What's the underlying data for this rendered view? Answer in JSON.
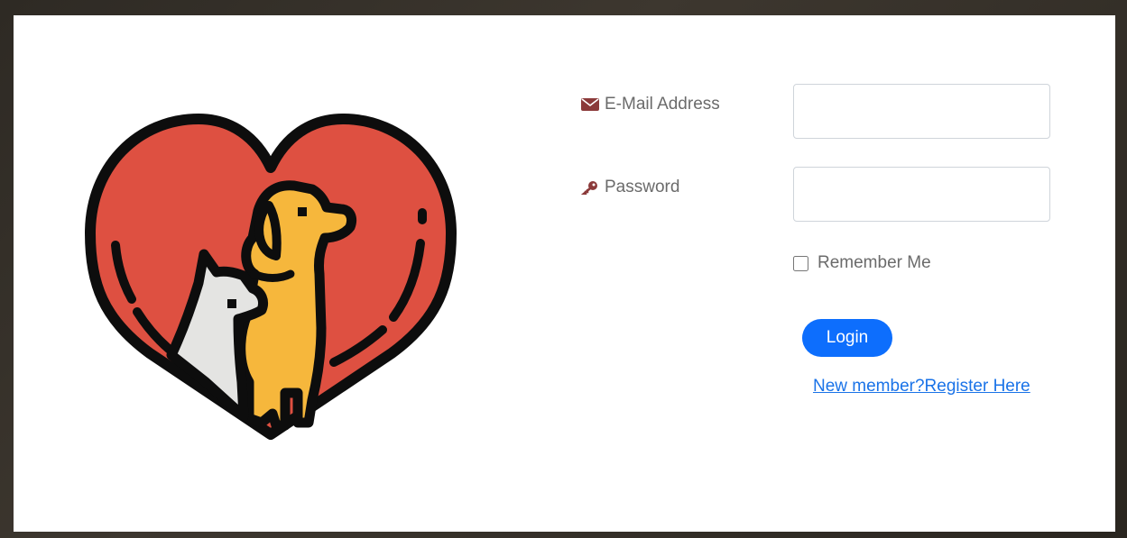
{
  "logo": {
    "icon": "pets-heart-logo",
    "colors": {
      "heart": "#de5041",
      "dog": "#f6b73c",
      "cat": "#e4e4e2",
      "outline": "#0d0d0d"
    }
  },
  "form": {
    "email": {
      "label": "E-Mail Address",
      "icon": "envelope-icon",
      "value": "",
      "placeholder": ""
    },
    "password": {
      "label": "Password",
      "icon": "key-icon",
      "value": "",
      "placeholder": ""
    },
    "remember": {
      "label": "Remember Me",
      "checked": false
    },
    "login_label": "Login",
    "register_link": "New member?Register Here"
  },
  "colors": {
    "accent": "#0d6efd",
    "link": "#1a73e8",
    "label_icon": "#8b3a3a",
    "frame": "#3b352d"
  }
}
